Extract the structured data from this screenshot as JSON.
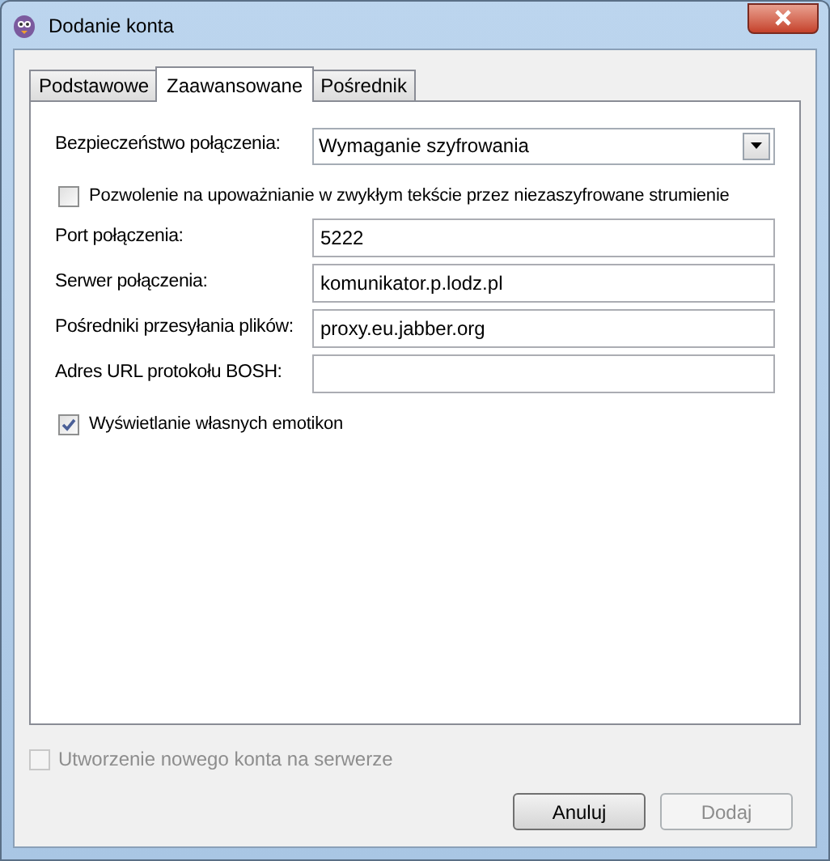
{
  "window": {
    "title": "Dodanie konta"
  },
  "tabs": [
    {
      "label": "Podstawowe",
      "selected": false
    },
    {
      "label": "Zaawansowane",
      "selected": true
    },
    {
      "label": "Pośrednik",
      "selected": false
    }
  ],
  "rows": [
    {
      "kind": "select",
      "label": "Bezpieczeństwo połączenia:",
      "value": "Wymaganie szyfrowania"
    },
    {
      "kind": "checkbox",
      "label": "Pozwolenie na upoważnianie w zwykłym tekście przez niezaszyfrowane strumienie",
      "checked": false
    },
    {
      "kind": "input",
      "label": "Port połączenia:",
      "value": "5222"
    },
    {
      "kind": "input",
      "label": "Serwer połączenia:",
      "value": "komunikator.p.lodz.pl"
    },
    {
      "kind": "input",
      "label": "Pośredniki przesyłania plików:",
      "value": "proxy.eu.jabber.org"
    },
    {
      "kind": "input",
      "label": "Adres URL protokołu BOSH:"
    },
    {
      "kind": "checkbox",
      "label": "Wyświetlanie własnych emotikon",
      "checked": true
    }
  ],
  "register": {
    "label": "Utworzenie nowego konta na serwerze",
    "checked": false,
    "disabled": true
  },
  "buttons": [
    {
      "label": "Anuluj",
      "disabled": false
    },
    {
      "label": "Dodaj",
      "disabled": true
    }
  ]
}
